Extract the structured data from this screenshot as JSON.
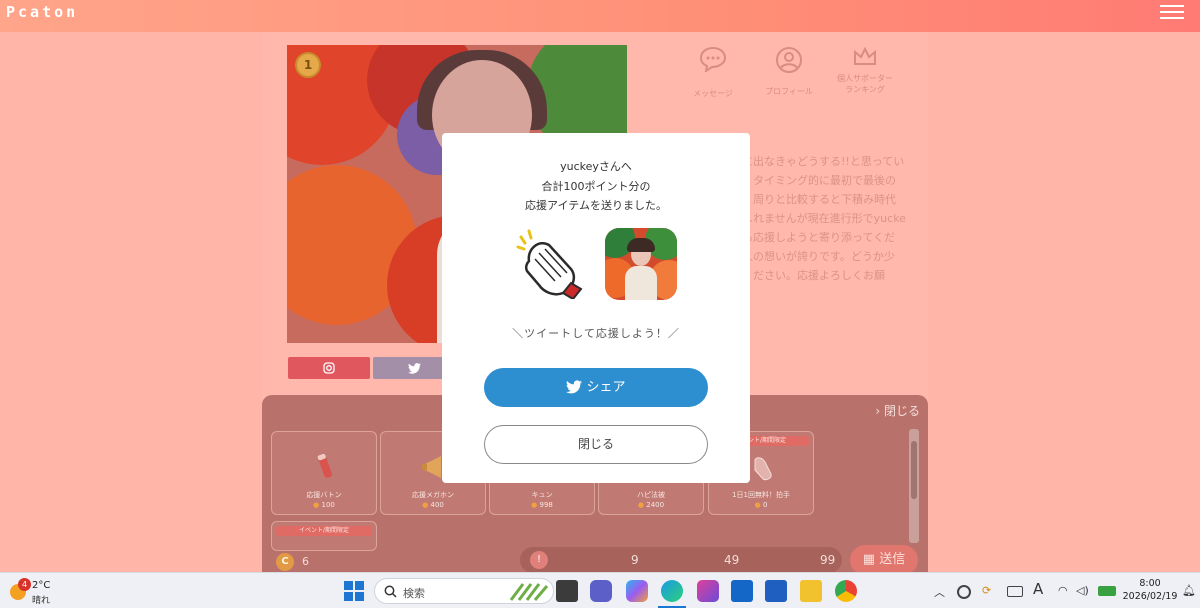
{
  "app": {
    "logo": "Pcaton"
  },
  "profile_nav": [
    {
      "label": "メッセージ",
      "icon": "speech-bubble-icon"
    },
    {
      "label": "プロフィール",
      "icon": "user-icon"
    },
    {
      "label_l1": "個人サポーター",
      "label_l2": "ランキング",
      "icon": "crown-icon"
    }
  ],
  "rank_medal": "1",
  "bio_lines": [
    "に出なきゃどうする!!と思ってい",
    "。タイミング的に最初で最後の",
    "。周りと比較すると下積み時代",
    "しれませんが現在進行形でyucke",
    "も応援しようと寄り添ってくだ",
    "人の想いが誇りです。どうか少",
    "ください。応援よろしくお願"
  ],
  "gift_panel": {
    "close_label": "閉じる",
    "items": [
      {
        "name": "応援バトン",
        "cost": "100",
        "tag": ""
      },
      {
        "name": "応援メガホン",
        "cost": "400",
        "tag": ""
      },
      {
        "name": "キュン",
        "cost": "998",
        "tag": ""
      },
      {
        "name": "ハピ法被",
        "cost": "2400",
        "tag": ""
      },
      {
        "name": "1日1回無料！拍手",
        "cost": "0",
        "tag": "イベント/期間限定"
      }
    ],
    "extra_tag": "イベント/期間限定",
    "coin_letter": "C",
    "coin_balance": "6",
    "quantities": [
      "9",
      "49",
      "99"
    ],
    "send_label": "送信"
  },
  "modal": {
    "line1": "yuckeyさんへ",
    "line2": "合計100ポイント分の",
    "line3": "応援アイテムを送りました。",
    "tweet_prompt": "＼ツイートして応援しよう！／",
    "share_label": "シェア",
    "close_label": "閉じる"
  },
  "taskbar": {
    "weather_badge": "4",
    "temperature": "2°C",
    "condition": "晴れ",
    "search_placeholder": "検索",
    "time": "8:00",
    "date": "2026/02/19",
    "ime_label": "A"
  },
  "colors": {
    "accent_blue": "#2e8fd0",
    "header_gradient_start": "#ffa58a",
    "header_gradient_end": "#ff7b74"
  }
}
